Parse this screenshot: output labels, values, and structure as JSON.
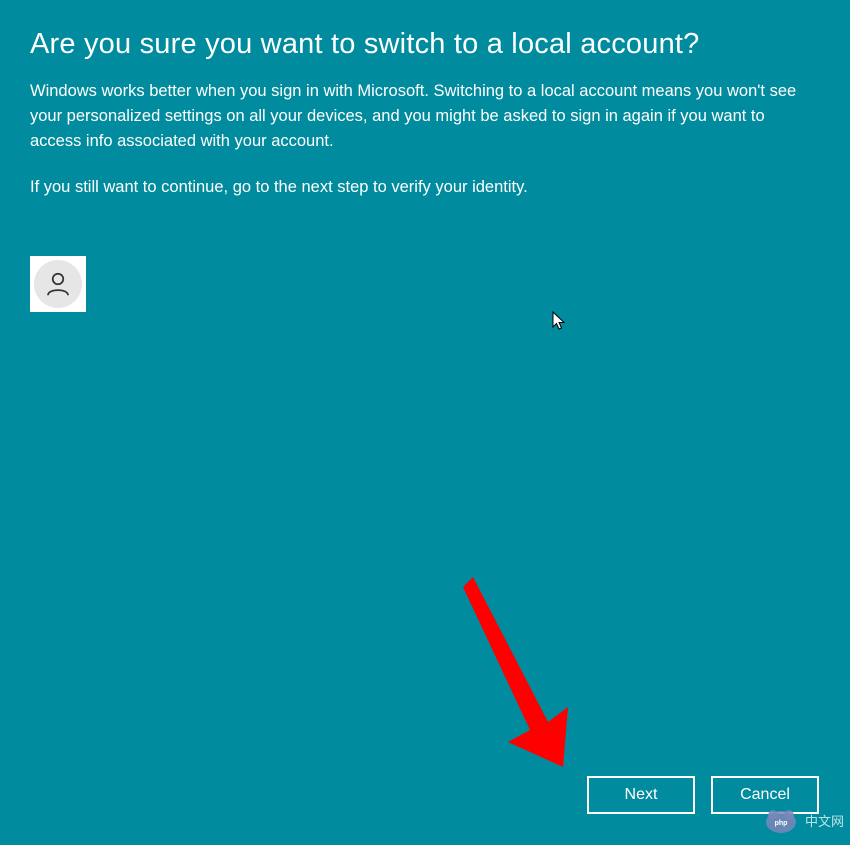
{
  "dialog": {
    "heading": "Are you sure you want to switch to a local account?",
    "body": "Windows works better when you sign in with Microsoft. Switching to a local account means you won't see your personalized settings on all your devices, and you might be asked to sign in again if you want to access info associated with your account.",
    "continue": "If you still want to continue, go to the next step to verify your identity."
  },
  "buttons": {
    "next": "Next",
    "cancel": "Cancel"
  },
  "watermark": {
    "text": "中文网"
  },
  "colors": {
    "background": "#008c9e",
    "text": "#ffffff",
    "annotation": "#ff0000"
  }
}
